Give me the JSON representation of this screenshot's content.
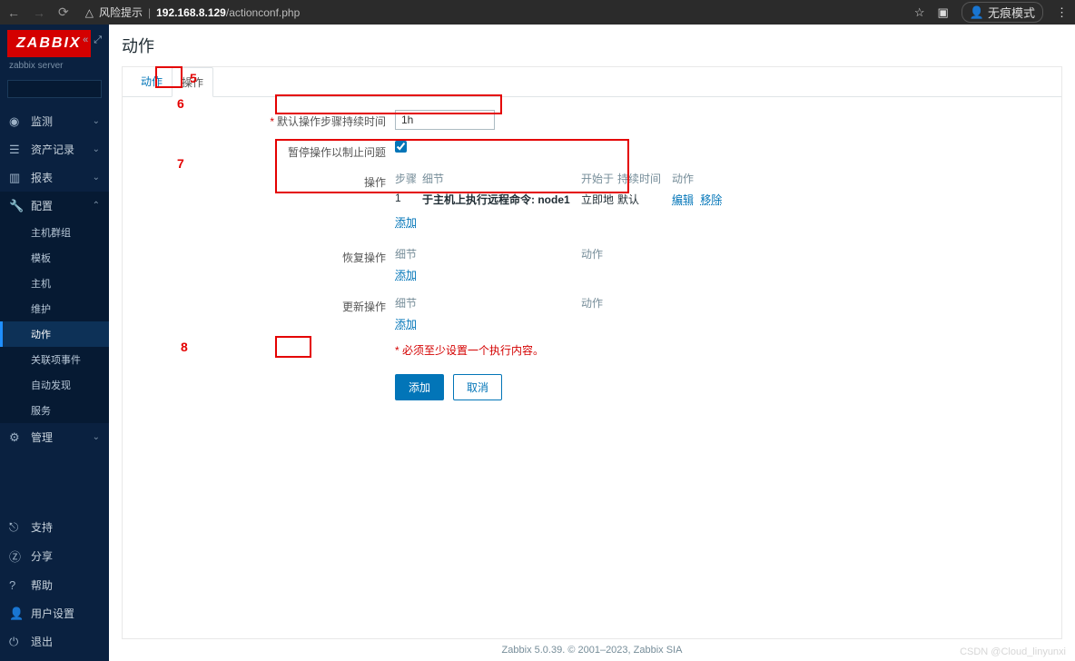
{
  "browser": {
    "warn_label": "风险提示",
    "url_host": "192.168.8.129",
    "url_path": "/actionconf.php",
    "incognito": "无痕模式"
  },
  "sidebar": {
    "logo": "ZABBIX",
    "server": "zabbix server",
    "sections": {
      "monitor": "监测",
      "assets": "资产记录",
      "reports": "报表",
      "config": "配置",
      "admin": "管理"
    },
    "config_items": [
      "主机群组",
      "模板",
      "主机",
      "维护",
      "动作",
      "关联项事件",
      "自动发现",
      "服务"
    ],
    "bottom": {
      "support": "支持",
      "share": "分享",
      "help": "帮助",
      "usersettings": "用户设置",
      "logout": "退出"
    }
  },
  "page": {
    "title": "动作",
    "tabs": {
      "action": "动作",
      "ops": "操作"
    },
    "labels": {
      "default_step_duration": "默认操作步骤持续时间",
      "pause": "暂停操作以制止问题",
      "operations": "操作",
      "recovery": "恢复操作",
      "update": "更新操作"
    },
    "step_duration_value": "1h",
    "pause_checked": true,
    "ops_table": {
      "headers": {
        "step": "步骤",
        "detail": "细节",
        "start": "开始于",
        "duration": "持续时间",
        "action": "动作"
      },
      "row": {
        "step": "1",
        "detail": "于主机上执行远程命令: node1",
        "start": "立即地",
        "duration": "默认",
        "edit": "编辑",
        "remove": "移除"
      },
      "add": "添加"
    },
    "sub_table": {
      "detail": "细节",
      "action": "动作",
      "add": "添加"
    },
    "require_msg": "必须至少设置一个执行内容。",
    "buttons": {
      "add": "添加",
      "cancel": "取消"
    }
  },
  "annotations": {
    "n5": "5",
    "n6": "6",
    "n7": "7",
    "n8": "8"
  },
  "footer": "Zabbix 5.0.39. © 2001–2023, Zabbix SIA",
  "watermark": "CSDN @Cloud_linyunxi"
}
